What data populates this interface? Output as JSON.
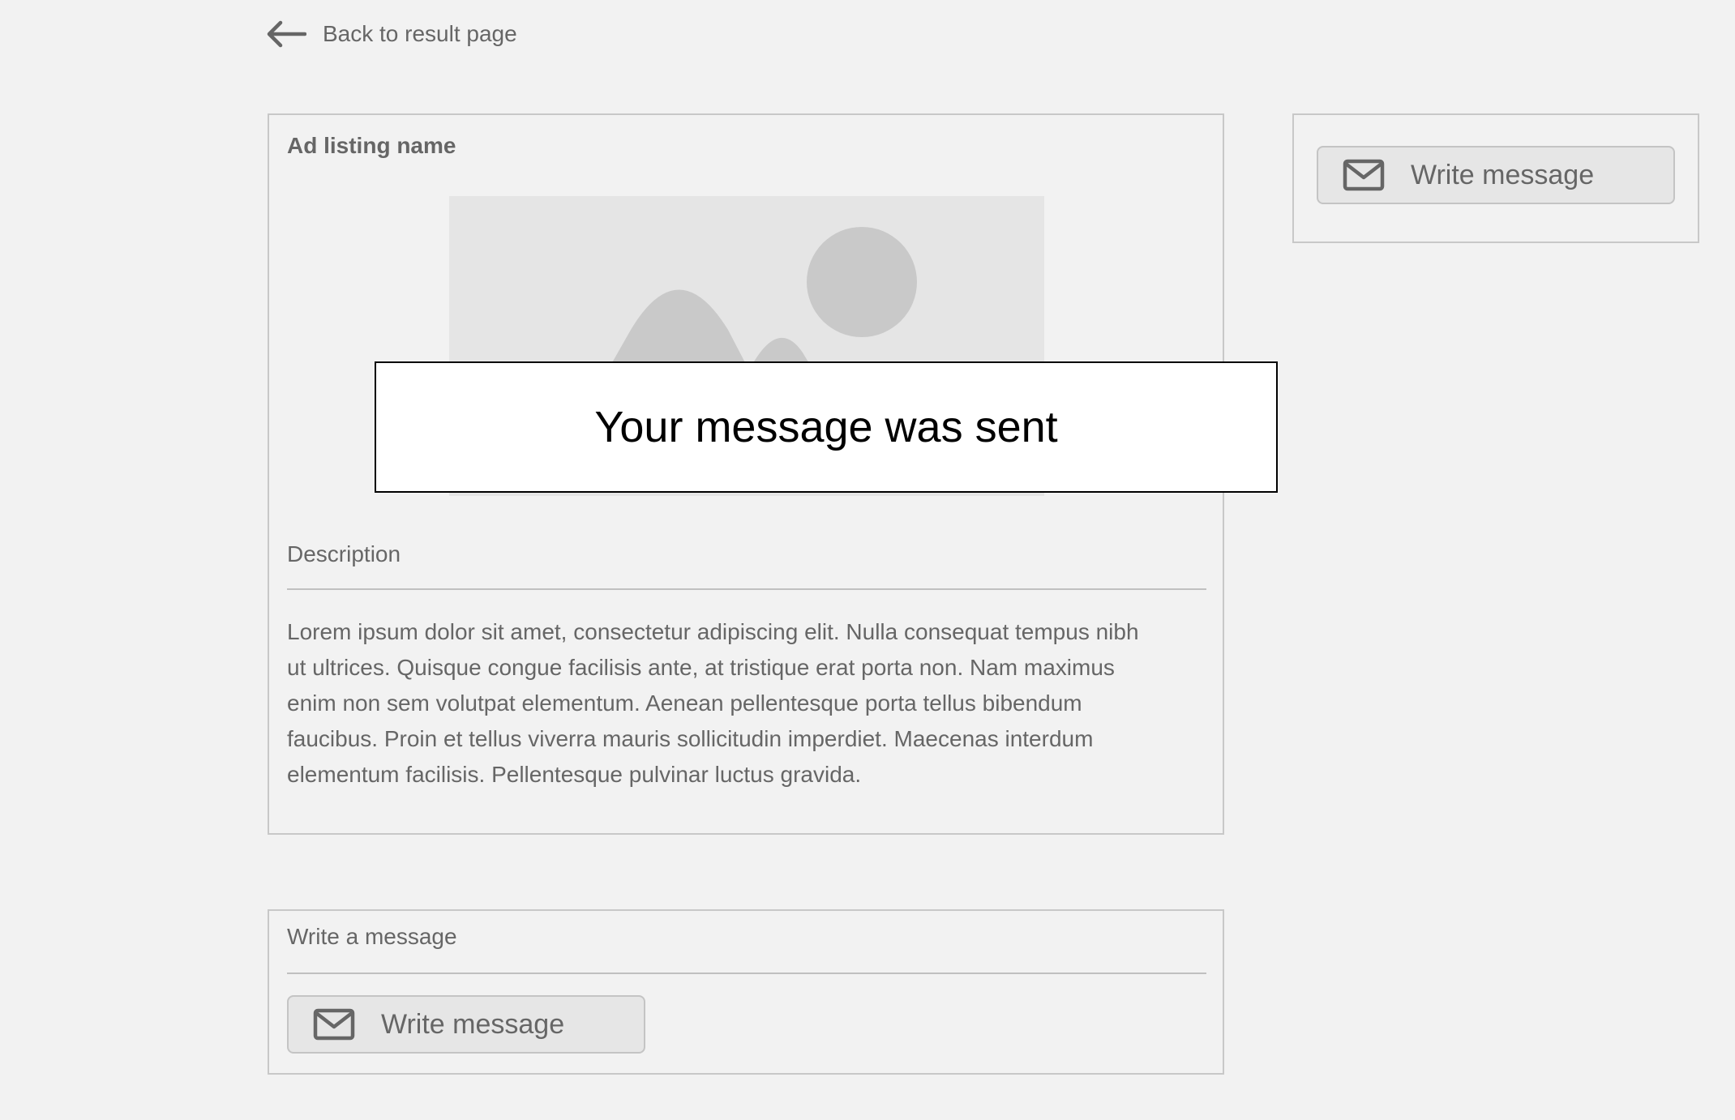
{
  "nav": {
    "back_label": "Back to result page",
    "back_icon": "arrow-left-icon"
  },
  "listing": {
    "title": "Ad listing name",
    "image_icon": "image-placeholder-icon",
    "description_heading": "Description",
    "description_text": "Lorem ipsum dolor sit amet, consectetur adipiscing elit. Nulla consequat tempus nibh ut ultrices. Quisque congue facilisis ante, at tristique erat porta non. Nam maximus enim non sem volutpat elementum. Aenean pellentesque porta tellus bibendum faucibus. Proin et tellus viverra mauris sollicitudin imperdiet. Maecenas interdum elementum facilisis. Pellentesque pulvinar luctus gravida."
  },
  "side_panel": {
    "button_label": "Write message",
    "button_icon": "mail-icon"
  },
  "write_section": {
    "heading": "Write a message",
    "button_label": "Write message",
    "button_icon": "mail-icon"
  },
  "toast": {
    "message": "Your message was sent"
  },
  "colors": {
    "background": "#f2f2f2",
    "border": "#c8c8c8",
    "text": "#666666",
    "button_bg": "#e6e6e6",
    "placeholder_bg": "#e5e5e5",
    "placeholder_shape": "#c9c9c9",
    "toast_bg": "#ffffff",
    "toast_text": "#000000"
  }
}
